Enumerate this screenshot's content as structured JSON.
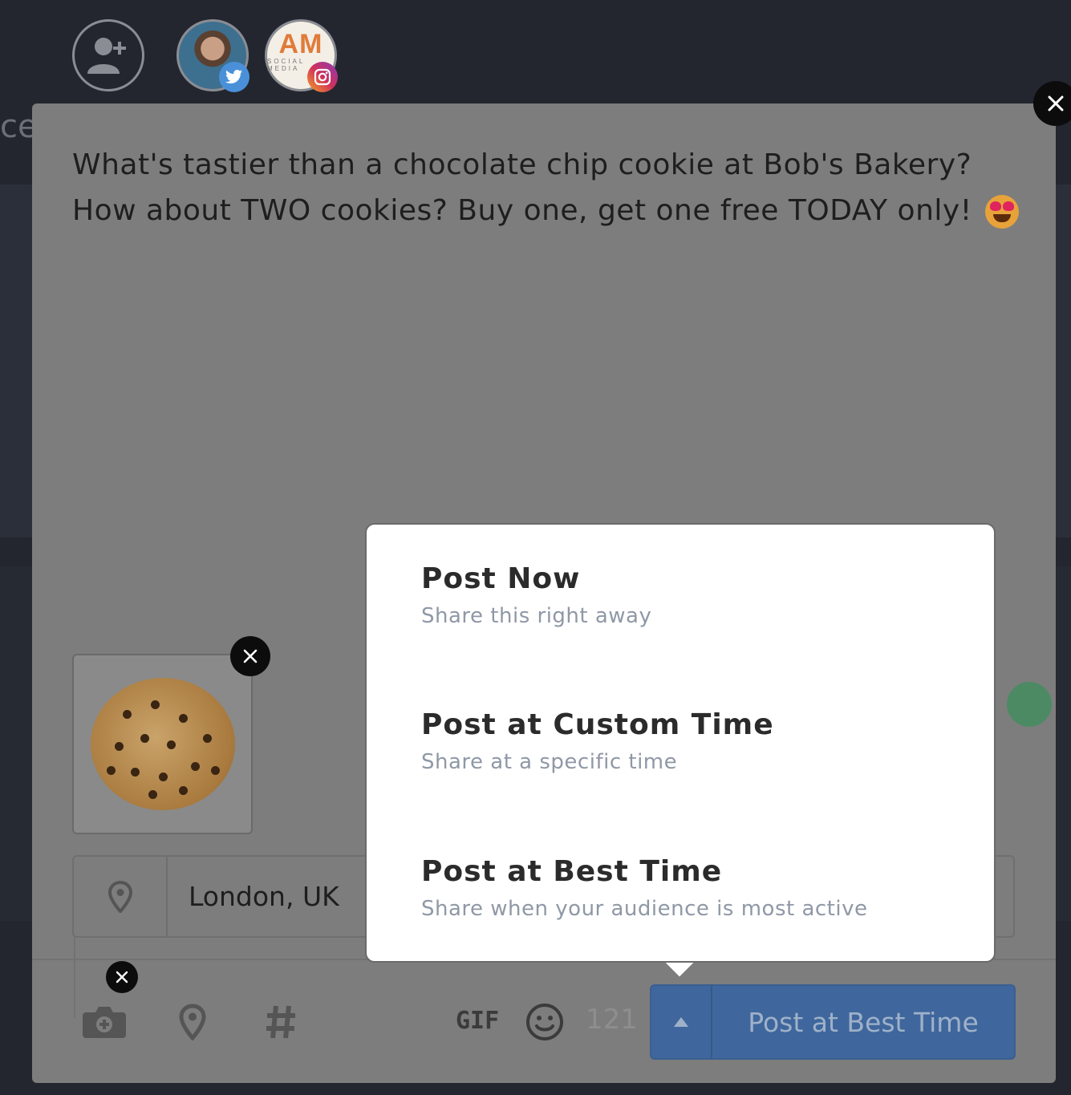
{
  "composer": {
    "text": "What's tastier than a chocolate chip cookie at Bob's Bakery? How about TWO cookies? Buy one, get one free TODAY only!",
    "emoji": "heart-eyes-emoji",
    "location_value": "London, UK",
    "char_count": "121",
    "gif_label": "GIF",
    "post_button_label": "Post at Best Time"
  },
  "accounts": {
    "am_logo_letters": "AM",
    "am_logo_sub": "SOCIAL MEDIA"
  },
  "menu": {
    "items": [
      {
        "title": "Post Now",
        "subtitle": "Share this right away"
      },
      {
        "title": "Post at Custom Time",
        "subtitle": "Share at a specific time"
      },
      {
        "title": "Post at Best Time",
        "subtitle": "Share when your audience is most active"
      }
    ]
  },
  "background": {
    "partial_text": "ce"
  },
  "colors": {
    "post_button": "#3f679d",
    "menu_background": "#ffffff",
    "overlay": "#7d7d7d",
    "twitter_badge": "#4a90d9"
  }
}
